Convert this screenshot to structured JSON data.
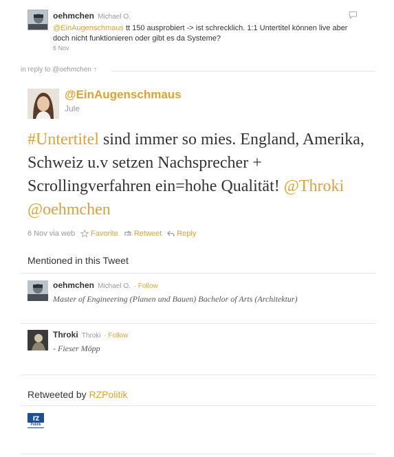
{
  "reply_tweet": {
    "username": "oehmchen",
    "fullname": "Michael O.",
    "mention": "@EinAugenschmaus",
    "text": " tt 150 ausprobiert -> ist schrecklich. 1:1 Untertitel können live aber doch nicht funktionieren oder gibt es da Systeme?",
    "date": "6 Nov"
  },
  "in_reply_to": "in reply to @oehmchen ↑",
  "main_tweet": {
    "handle": "@EinAugenschmaus",
    "name": "Jule",
    "hashtag": "#Untertitel",
    "text": " sind immer so mies. England, Amerika, Schweiz u.v setzen Nachsprecher + Scrollingverfahren ein=hohe Qualität! ",
    "mention_1": "@Throki",
    "mention_2": "@oehmchen",
    "meta": "6 Nov via web",
    "favorite_label": "Favorite",
    "retweet_label": "Retweet",
    "reply_label": "Reply"
  },
  "mentioned": {
    "title": "Mentioned in this Tweet",
    "users": [
      {
        "username": "oehmchen",
        "fullname": "Michael O.",
        "separator": " · ",
        "follow_label": "Follow",
        "bio": "Master of Engineering (Planen und Bauen) Bachelor of Arts (Architektur)"
      },
      {
        "username": "Throki",
        "fullname": "Throki",
        "separator": " · ",
        "follow_label": "Follow",
        "bio": "- Fieser Möpp"
      }
    ]
  },
  "retweeted": {
    "title": "Retweeted by ",
    "user": "RZPolitik",
    "logo_text": "rz",
    "logo_sub": "Politik"
  },
  "colors": {
    "link": "#e0a22e",
    "muted": "#999999",
    "text": "#333333",
    "divider": "#e3e3e3"
  }
}
